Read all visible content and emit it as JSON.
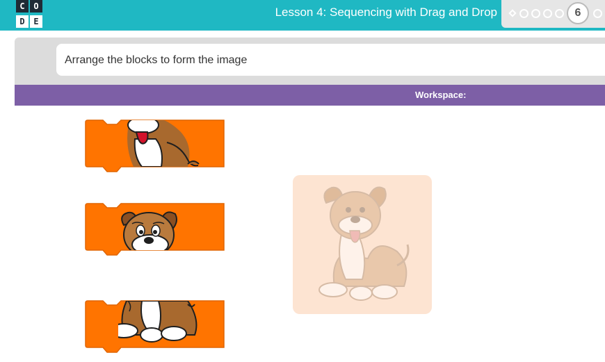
{
  "header": {
    "logo_letters": [
      "C",
      "O",
      "D",
      "E"
    ],
    "lesson_title": "Lesson 4: Sequencing with Drag and Drop",
    "current_puzzle": "6"
  },
  "instructions": {
    "text": "Arrange the blocks to form the image"
  },
  "workspace": {
    "label": "Workspace:"
  },
  "blocks": [
    {
      "name": "block-puppy-middle",
      "image": "puppy-middle-slice-icon"
    },
    {
      "name": "block-puppy-top",
      "image": "puppy-head-slice-icon"
    },
    {
      "name": "block-puppy-bottom",
      "image": "puppy-feet-slice-icon"
    }
  ],
  "target": {
    "image": "puppy-target-image-icon"
  },
  "colors": {
    "header": "#1fb8c3",
    "workspace_header": "#7d5fa6",
    "block": "#ff7400",
    "target_bg": "#fde4d2"
  }
}
